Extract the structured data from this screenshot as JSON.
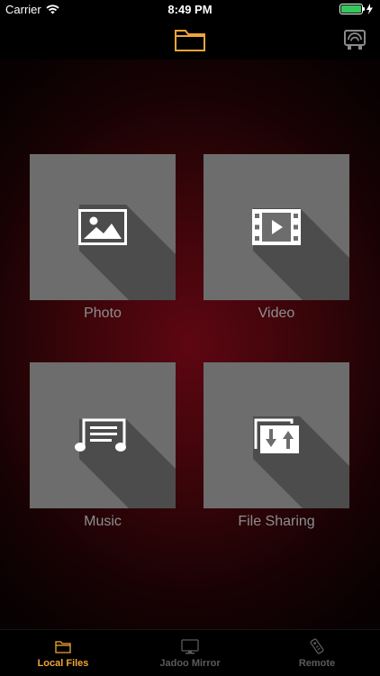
{
  "status_bar": {
    "carrier": "Carrier",
    "time": "8:49 PM"
  },
  "nav": {
    "folder_icon": "folder-icon",
    "cast_icon": "cast-icon"
  },
  "tiles": [
    {
      "label": "Photo",
      "icon": "photo-icon"
    },
    {
      "label": "Video",
      "icon": "video-icon"
    },
    {
      "label": "Music",
      "icon": "music-icon"
    },
    {
      "label": "File Sharing",
      "icon": "file-sharing-icon"
    }
  ],
  "tab_bar": {
    "items": [
      {
        "label": "Local Files",
        "icon": "folder-icon",
        "active": true
      },
      {
        "label": "Jadoo Mirror",
        "icon": "tv-icon",
        "active": false
      },
      {
        "label": "Remote",
        "icon": "remote-icon",
        "active": false
      }
    ]
  },
  "colors": {
    "accent": "#f0a538",
    "tile_bg": "#6d6d6d",
    "label_gray": "#8e8e8e",
    "background_center": "#5e0612"
  }
}
